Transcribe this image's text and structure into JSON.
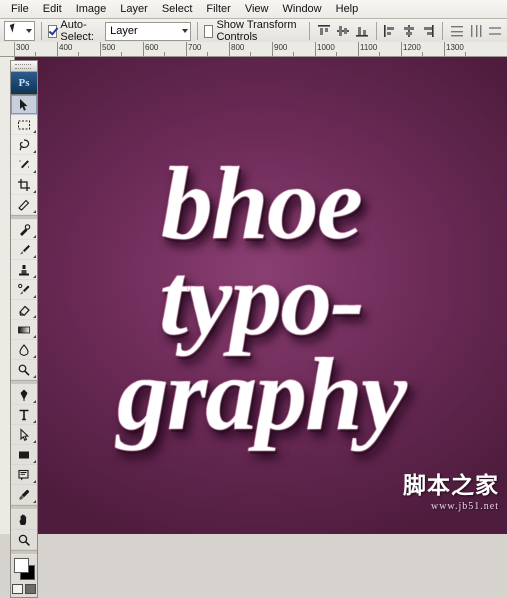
{
  "app": {
    "name": "Adobe Photoshop",
    "logo_text": "Ps"
  },
  "menubar": {
    "items": [
      {
        "label": "File"
      },
      {
        "label": "Edit"
      },
      {
        "label": "Image"
      },
      {
        "label": "Layer"
      },
      {
        "label": "Select"
      },
      {
        "label": "Filter"
      },
      {
        "label": "View"
      },
      {
        "label": "Window"
      },
      {
        "label": "Help"
      }
    ]
  },
  "options_bar": {
    "tool_preset_name": "move-tool-preset",
    "auto_select_checked": true,
    "auto_select_label": "Auto-Select:",
    "auto_select_target": "Layer",
    "show_transform_label": "Show Transform Controls",
    "show_transform_checked": false,
    "align_buttons": [
      {
        "name": "align-top-edges"
      },
      {
        "name": "align-vertical-centers"
      },
      {
        "name": "align-bottom-edges"
      },
      {
        "name": "align-left-edges"
      },
      {
        "name": "align-horizontal-centers"
      },
      {
        "name": "align-right-edges"
      }
    ],
    "distribute_buttons": [
      {
        "name": "distribute-top-edges"
      },
      {
        "name": "distribute-vertical-centers"
      },
      {
        "name": "distribute-bottom-edges"
      }
    ]
  },
  "ruler": {
    "unit": "px",
    "labels": [
      "300",
      "400",
      "500",
      "600",
      "700",
      "800",
      "900",
      "1000",
      "1100",
      "1200",
      "1300"
    ]
  },
  "toolbox": {
    "tools": [
      {
        "name": "move-tool",
        "selected": true
      },
      {
        "name": "rectangular-marquee-tool",
        "selected": false
      },
      {
        "name": "lasso-tool",
        "selected": false
      },
      {
        "name": "magic-wand-tool",
        "selected": false
      },
      {
        "name": "crop-tool",
        "selected": false
      },
      {
        "name": "eyedropper-tool",
        "selected": false
      },
      {
        "name": "healing-brush-tool",
        "selected": false
      },
      {
        "name": "brush-tool",
        "selected": false
      },
      {
        "name": "clone-stamp-tool",
        "selected": false
      },
      {
        "name": "history-brush-tool",
        "selected": false
      },
      {
        "name": "eraser-tool",
        "selected": false
      },
      {
        "name": "gradient-tool",
        "selected": false
      },
      {
        "name": "blur-tool",
        "selected": false
      },
      {
        "name": "dodge-tool",
        "selected": false
      },
      {
        "name": "pen-tool",
        "selected": false
      },
      {
        "name": "horizontal-type-tool",
        "selected": false
      },
      {
        "name": "path-selection-tool",
        "selected": false
      },
      {
        "name": "rectangle-shape-tool",
        "selected": false
      },
      {
        "name": "notes-tool",
        "selected": false
      },
      {
        "name": "hand-tool",
        "selected": false
      },
      {
        "name": "zoom-tool",
        "selected": false
      }
    ],
    "foreground_color": "#ffffff",
    "background_color": "#000000"
  },
  "canvas": {
    "background_color": "#6d2b5a",
    "artwork_lines": [
      "bhoe",
      "typo-",
      "graphy"
    ],
    "artwork_description": "candy-cane striped script lettering"
  },
  "watermark": {
    "main": "脚本之家",
    "sub": "www.jb51.net"
  }
}
